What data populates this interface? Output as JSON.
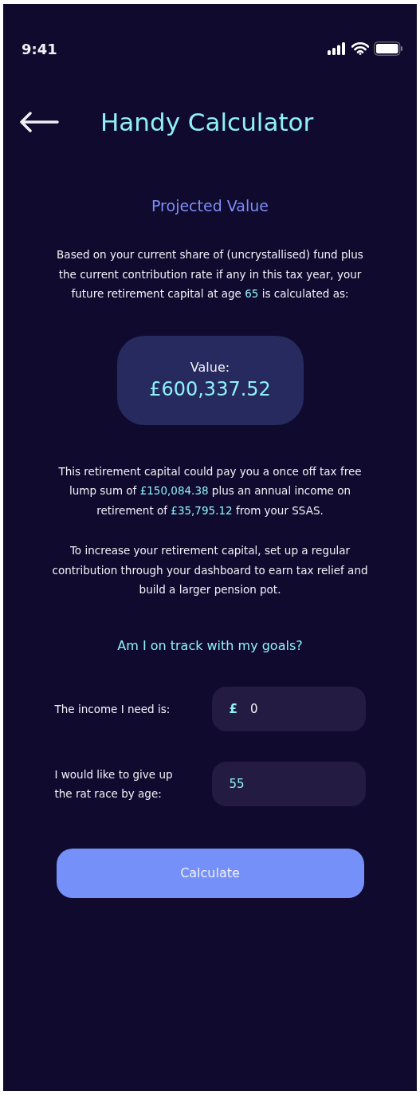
{
  "status_bar": {
    "time": "9:41"
  },
  "header": {
    "title": "Handy Calculator"
  },
  "section_title": "Projected Value",
  "intro": [
    {
      "text": "Based on your current share of (uncrystallised) fund plus the current contribution rate if any in this tax year, your future retirement capital at age ",
      "highlight": false
    },
    {
      "text": "65",
      "highlight": true
    },
    {
      "text": " is calculated as:",
      "highlight": false
    }
  ],
  "value_card": {
    "label": "Value:",
    "amount": "£600,337.52"
  },
  "result": [
    {
      "text": "This retirement capital could pay you a once off tax free lump sum of ",
      "highlight": false
    },
    {
      "text": "£150,084.38",
      "highlight": true
    },
    {
      "text": " plus an annual income on retirement of ",
      "highlight": false
    },
    {
      "text": "£35,795.12",
      "highlight": true
    },
    {
      "text": " from your SSAS.",
      "highlight": false
    }
  ],
  "advice": "To increase your retirement capital, set up a regular contribution through your dashboard to earn tax relief and build a larger pension pot.",
  "goals_title": "Am I on track with my goals?",
  "fields": [
    {
      "label": "The income I need is:",
      "prefix": "£",
      "value": "0",
      "highlight": false
    },
    {
      "label": "I would like to give up the rat race by age:",
      "value": "55",
      "highlight": true
    }
  ],
  "button": "Calculate"
}
